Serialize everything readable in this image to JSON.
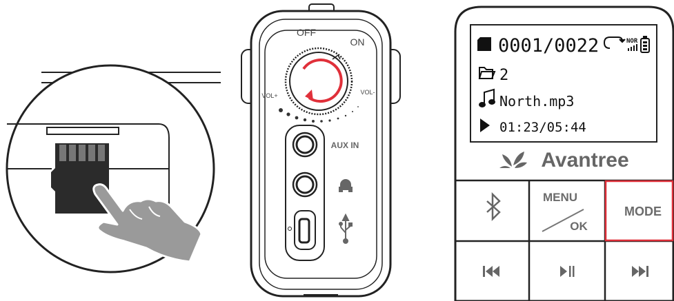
{
  "radio": {
    "knob": {
      "off_label": "OFF",
      "on_label": "ON",
      "vol_plus_label": "VOL+",
      "vol_minus_label": "VOL-"
    },
    "aux_label": "AUX IN"
  },
  "player": {
    "screen": {
      "track_counter": "0001/0022",
      "eq_label": "NOR",
      "folder": "2",
      "filename": "North.mp3",
      "time": "01:23/05:44"
    },
    "brand": "Avantree",
    "buttons": {
      "bluetooth_icon": "bluetooth-icon",
      "menu_label": "MENU",
      "ok_label": "OK",
      "mode_label": "MODE",
      "prev_icon": "prev-icon",
      "play_pause_icon": "play-pause-icon",
      "next_icon": "next-icon"
    },
    "highlight_color": "#e0303a"
  }
}
